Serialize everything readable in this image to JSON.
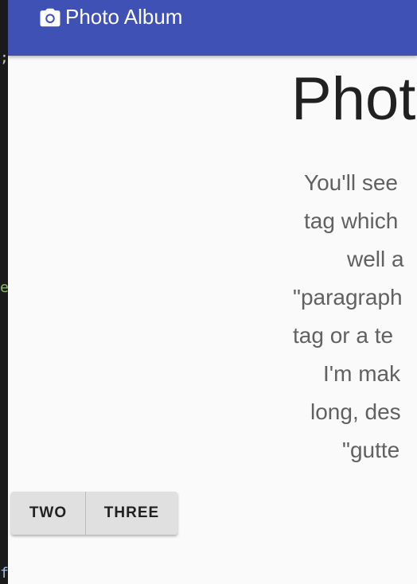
{
  "editor": {
    "fragments": [
      ";",
      "e",
      "f"
    ]
  },
  "appbar": {
    "title": "Photo Album",
    "icon": "camera-icon",
    "color": "#3f51b5"
  },
  "hero": {
    "title": "Phot",
    "lines": [
      "You'll see",
      "tag which",
      "well a",
      "\"paragraph",
      "tag or a te",
      "I'm mak",
      "long, des",
      "\"gutte"
    ]
  },
  "buttons": {
    "two": "TWO",
    "three": "THREE"
  }
}
